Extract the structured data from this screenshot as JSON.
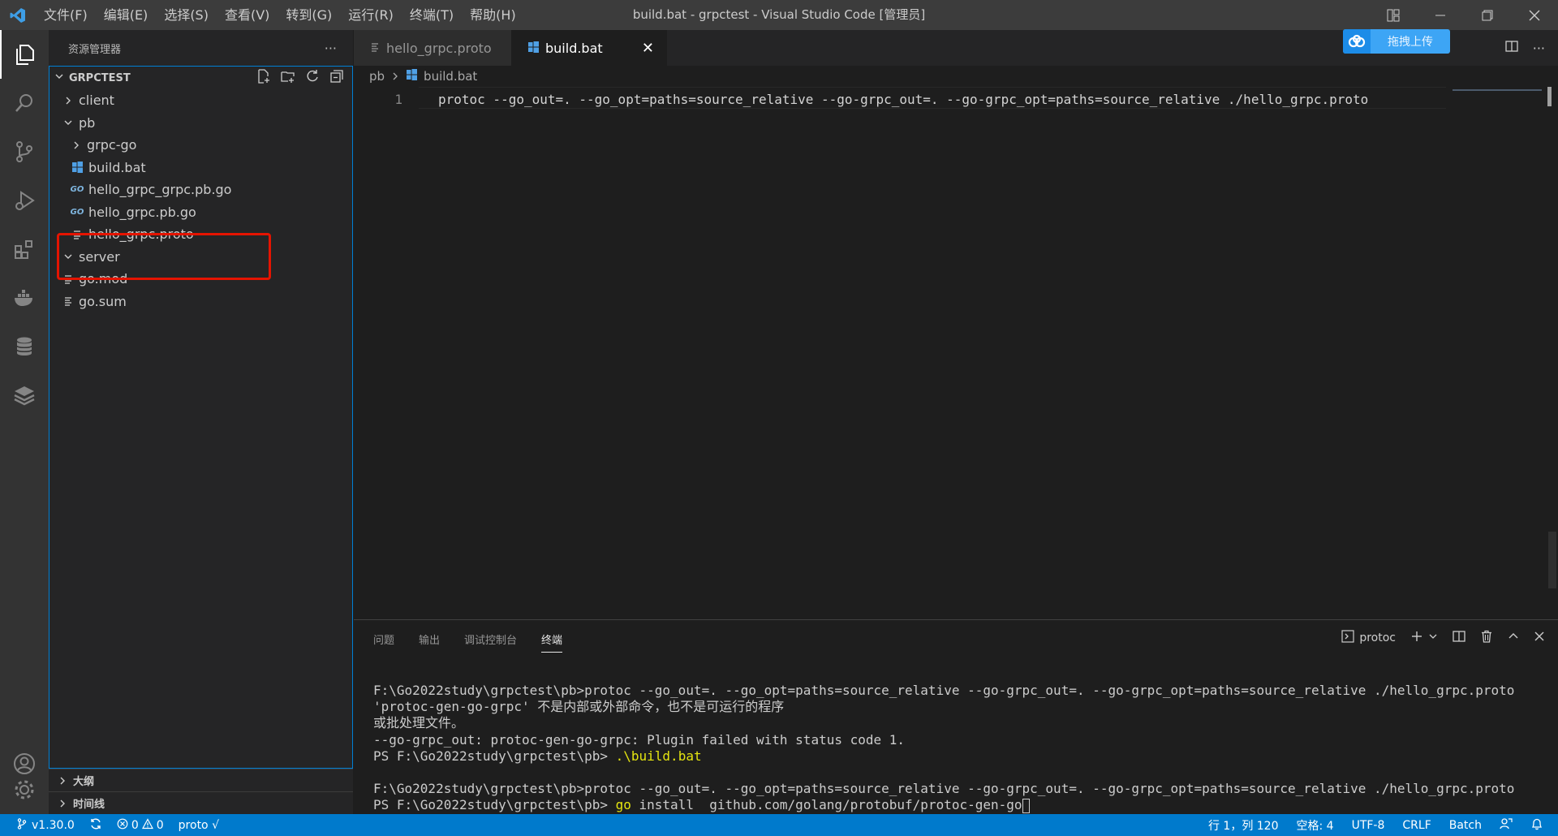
{
  "titlebar": {
    "menus": [
      "文件(F)",
      "编辑(E)",
      "选择(S)",
      "查看(V)",
      "转到(G)",
      "运行(R)",
      "终端(T)",
      "帮助(H)"
    ],
    "title": "build.bat - grpctest - Visual Studio Code [管理员]"
  },
  "activitybar": {
    "items": [
      "explorer-icon",
      "search-icon",
      "source-control-icon",
      "run-debug-icon",
      "extensions-icon",
      "docker-icon",
      "database-icon",
      "layers-icon"
    ],
    "bottom": [
      "account-icon",
      "settings-gear-icon"
    ]
  },
  "sidebar": {
    "header": "资源管理器",
    "more": "···",
    "root": "GRPCTEST",
    "tree": [
      {
        "label": "client",
        "kind": "folder",
        "expanded": false
      },
      {
        "label": "pb",
        "kind": "folder",
        "expanded": true
      },
      {
        "label": "grpc-go",
        "kind": "folder",
        "expanded": false
      },
      {
        "label": "build.bat",
        "kind": "bat"
      },
      {
        "label": "hello_grpc_grpc.pb.go",
        "kind": "go"
      },
      {
        "label": "hello_grpc.pb.go",
        "kind": "go"
      },
      {
        "label": "hello_grpc.proto",
        "kind": "proto"
      },
      {
        "label": "server",
        "kind": "folder",
        "expanded": true
      },
      {
        "label": "go.mod",
        "kind": "text"
      },
      {
        "label": "go.sum",
        "kind": "text"
      }
    ],
    "outline": "大纲",
    "timeline": "时间线"
  },
  "tabs": [
    {
      "label": "hello_grpc.proto",
      "active": false
    },
    {
      "label": "build.bat",
      "active": true,
      "close": "✕"
    }
  ],
  "upload": {
    "label": "拖拽上传"
  },
  "breadcrumb": {
    "folder": "pb",
    "file": "build.bat"
  },
  "editor": {
    "line_number": "1",
    "code": "protoc --go_out=. --go_opt=paths=source_relative --go-grpc_out=. --go-grpc_opt=paths=source_relative ./hello_grpc.proto"
  },
  "panel": {
    "tabs": [
      "问题",
      "输出",
      "调试控制台",
      "终端"
    ],
    "active_tab": "终端",
    "terminal_name": "protoc",
    "lines": [
      {
        "text": "F:\\Go2022study\\grpctest\\pb>protoc --go_out=. --go_opt=paths=source_relative --go-grpc_out=. --go-grpc_opt=paths=source_relative ./hello_grpc.proto"
      },
      {
        "text": "'protoc-gen-go-grpc' 不是内部或外部命令，也不是可运行的程序"
      },
      {
        "text": "或批处理文件。"
      },
      {
        "text": "--go-grpc_out: protoc-gen-go-grpc: Plugin failed with status code 1."
      },
      {
        "prompt": "PS F:\\Go2022study\\grpctest\\pb> ",
        "cmd": ".\\build.bat"
      },
      {
        "text": ""
      },
      {
        "text": "F:\\Go2022study\\grpctest\\pb>protoc --go_out=. --go_opt=paths=source_relative --go-grpc_out=. --go-grpc_opt=paths=source_relative ./hello_grpc.proto"
      },
      {
        "prompt": "PS F:\\Go2022study\\grpctest\\pb> ",
        "cmd": "go",
        "rest": " install  github.com/golang/protobuf/protoc-gen-go"
      }
    ]
  },
  "statusbar": {
    "branch": "v1.30.0",
    "errors": "0",
    "warnings": "0",
    "proto": "proto √",
    "position": "行 1，列 120",
    "spaces": "空格: 4",
    "encoding": "UTF-8",
    "eol": "CRLF",
    "language": "Batch"
  }
}
